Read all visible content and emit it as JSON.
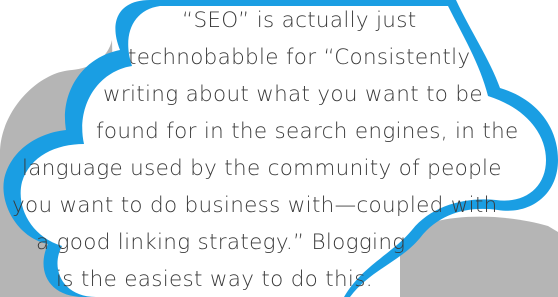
{
  "colors": {
    "cloud_fill": "#ffffff",
    "cloud_outline": "#1a9ee3",
    "shadow": "#b5b5b5",
    "text": "#3a3a3a",
    "background": "#ffffff"
  },
  "quote": {
    "lines": [
      "“SEO” is actually just",
      "technobabble for “Consistently",
      "writing about what you want to be",
      "found for in the search engines, in the",
      "language used by the community of people",
      "you want to do business with—coupled with",
      "a good linking strategy.” Blogging",
      "is the easiest way to do this."
    ]
  }
}
